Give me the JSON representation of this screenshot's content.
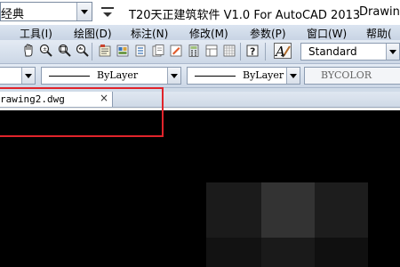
{
  "titlebar": {
    "workspace_value": "经典",
    "app_title": "T20天正建筑软件 V1.0 For AutoCAD 2013",
    "drawing_title": "Drawing"
  },
  "menu": {
    "items": [
      "工具(I)",
      "绘图(D)",
      "标注(N)",
      "修改(M)",
      "参数(P)",
      "窗口(W)",
      "帮助("
    ]
  },
  "toolbar": {
    "style_value": "Standard",
    "icons": [
      "pan-icon",
      "zoom-realtime-icon",
      "zoom-window-icon",
      "zoom-previous-icon",
      "properties-icon",
      "design-center-icon",
      "tool-palettes-icon",
      "sheet-set-icon",
      "markup-icon",
      "calculator-icon",
      "help-icon",
      "text-style-icon"
    ]
  },
  "properties": {
    "linetype_value": "ByLayer",
    "lineweight_value": "ByLayer",
    "color_value": "BYCOLOR"
  },
  "tabs": {
    "doc_name": "rawing2.dwg",
    "close_glyph": "×"
  },
  "colors": {
    "highlight": "#e0242b",
    "canvas": "#000000"
  }
}
